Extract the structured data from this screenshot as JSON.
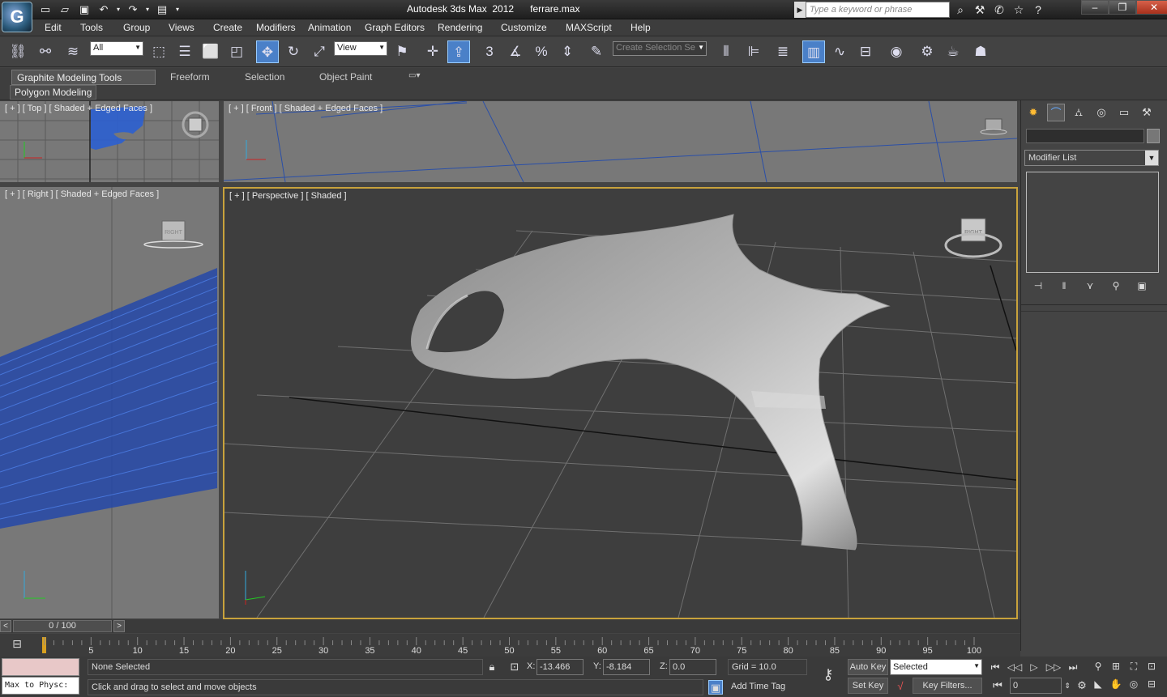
{
  "title": {
    "app": "Autodesk 3ds Max  2012",
    "file": "ferrare.max"
  },
  "search": {
    "placeholder": "Type a keyword or phrase"
  },
  "menu": [
    "Edit",
    "Tools",
    "Group",
    "Views",
    "Create",
    "Modifiers",
    "Animation",
    "Graph Editors",
    "Rendering",
    "Customize",
    "MAXScript",
    "Help"
  ],
  "toolbar": {
    "filter_value": "All",
    "coord_system": "View",
    "named_selection_placeholder": "Create Selection Se"
  },
  "ribbon": {
    "tabs": [
      "Graphite Modeling Tools",
      "Freeform",
      "Selection",
      "Object Paint"
    ],
    "subtab": "Polygon Modeling"
  },
  "viewports": {
    "top": "[ + ] [ Top ] [ Shaded + Edged Faces ]",
    "front": "[ + ] [ Front ] [ Shaded + Edged Faces ]",
    "right": "[ + ] [ Right ] [ Shaded + Edged Faces ]",
    "perspective": "[ + ] [ Perspective ] [ Shaded ]",
    "viewcube_label": "RIGHT"
  },
  "command_panel": {
    "modifier_list": "Modifier List"
  },
  "timeline": {
    "position": "0 / 100",
    "ticks": [
      "5",
      "10",
      "15",
      "20",
      "25",
      "30",
      "35",
      "40",
      "45",
      "50",
      "55",
      "60",
      "65",
      "70",
      "75",
      "80",
      "85",
      "90",
      "95",
      "100"
    ]
  },
  "status": {
    "maxscript_listener": "Max to Physc:",
    "selection": "None Selected",
    "prompt": "Click and drag to select and move objects",
    "x_label": "X:",
    "x_value": "-13.466",
    "y_label": "Y:",
    "y_value": "-8.184",
    "z_label": "Z:",
    "z_value": "0.0",
    "grid": "Grid = 10.0",
    "add_time_tag": "Add Time Tag",
    "auto_key": "Auto Key",
    "set_key": "Set Key",
    "key_mode": "Selected",
    "key_filters": "Key Filters...",
    "current_frame": "0"
  },
  "colors": {
    "accent": "#4a80c8",
    "viewport_bg": "#787878",
    "grid_blue": "#2a4fa8",
    "active_border": "#c8a23c"
  }
}
